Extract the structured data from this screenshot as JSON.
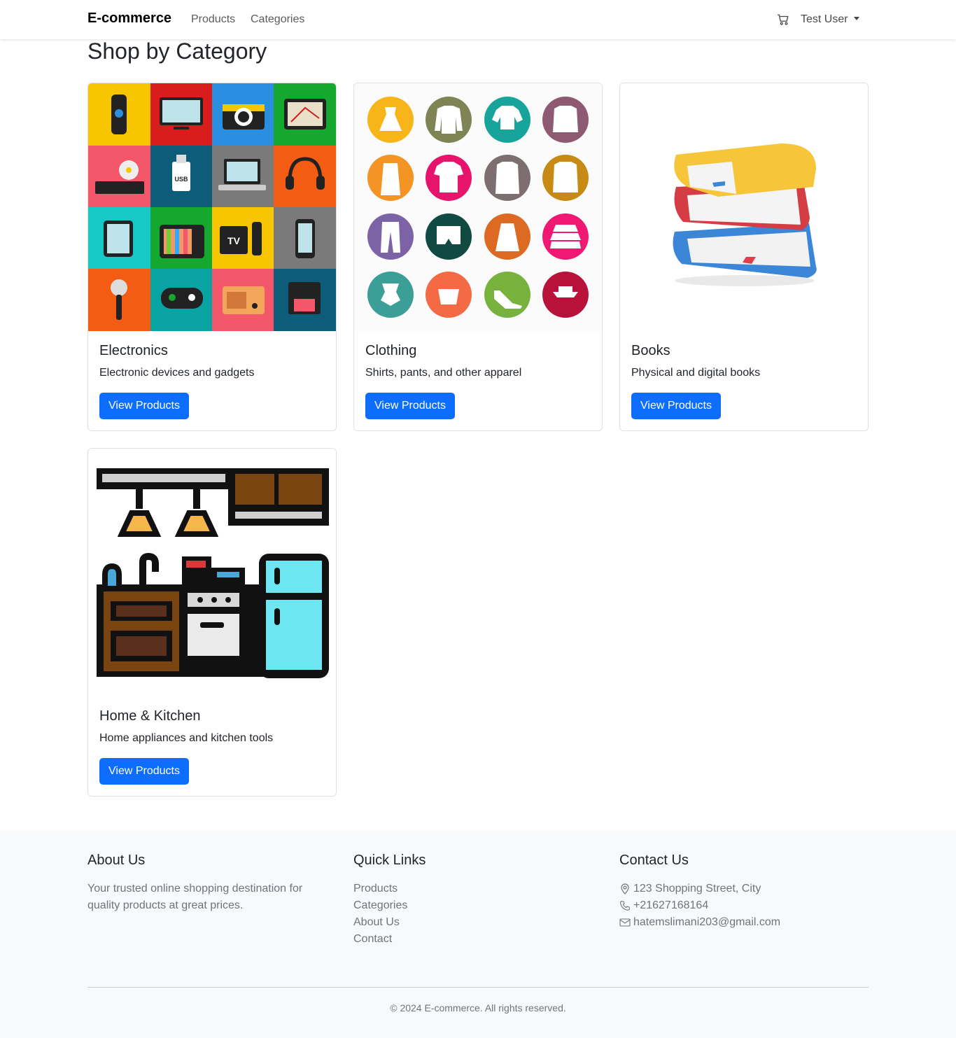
{
  "nav": {
    "brand": "E-commerce",
    "links": [
      "Products",
      "Categories"
    ],
    "user": "Test User"
  },
  "page": {
    "title": "Shop by Category"
  },
  "categories": [
    {
      "title": "Electronics",
      "description": "Electronic devices and gadgets",
      "button": "View Products"
    },
    {
      "title": "Clothing",
      "description": "Shirts, pants, and other apparel",
      "button": "View Products"
    },
    {
      "title": "Books",
      "description": "Physical and digital books",
      "button": "View Products"
    },
    {
      "title": "Home & Kitchen",
      "description": "Home appliances and kitchen tools",
      "button": "View Products"
    }
  ],
  "electronics_tile_text": {
    "usb": "USB",
    "tv": "TV"
  },
  "footer": {
    "about": {
      "heading": "About Us",
      "text_line1": "Your trusted online shopping destination for",
      "text_line2": "quality products at great prices."
    },
    "links": {
      "heading": "Quick Links",
      "items": [
        "Products",
        "Categories",
        "About Us",
        "Contact"
      ]
    },
    "contact": {
      "heading": "Contact Us",
      "address": "123 Shopping Street, City",
      "phone": "+21627168164",
      "email": "hatemslimani203@gmail.com"
    },
    "copyright": "© 2024 E-commerce. All rights reserved."
  },
  "colors": {
    "primary": "#0d6efd",
    "footer_bg": "#f8f9fa",
    "muted": "#6c757d"
  }
}
